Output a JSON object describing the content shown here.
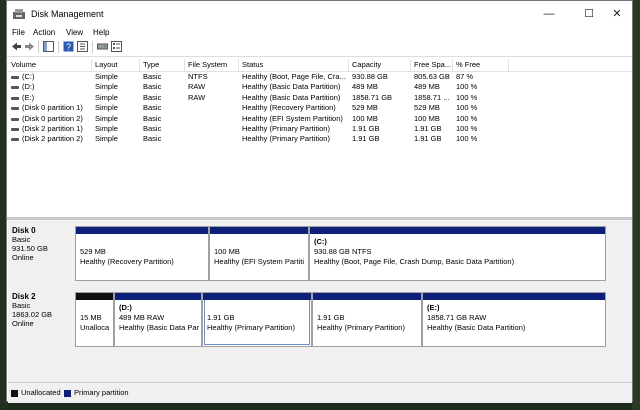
{
  "window": {
    "title": "Disk Management",
    "minimize": "—",
    "maximize": "☐",
    "close": "✕"
  },
  "menu": [
    "File",
    "Action",
    "View",
    "Help"
  ],
  "toolbar": [
    "back-arrow-icon",
    "forward-arrow-icon",
    "console-tree-icon",
    "help-icon",
    "properties-icon",
    "drive-icon",
    "list-icon"
  ],
  "table": {
    "columns": [
      "Volume",
      "Layout",
      "Type",
      "File System",
      "Status",
      "Capacity",
      "Free Spa...",
      "% Free"
    ],
    "rows": [
      [
        "(C:)",
        "Simple",
        "Basic",
        "NTFS",
        "Healthy (Boot, Page File, Cra...",
        "930.88 GB",
        "805.63 GB",
        "87 %"
      ],
      [
        "(D:)",
        "Simple",
        "Basic",
        "RAW",
        "Healthy (Basic Data Partition)",
        "489 MB",
        "489 MB",
        "100 %"
      ],
      [
        "(E:)",
        "Simple",
        "Basic",
        "RAW",
        "Healthy (Basic Data Partition)",
        "1858.71 GB",
        "1858.71 ...",
        "100 %"
      ],
      [
        "(Disk 0 partition 1)",
        "Simple",
        "Basic",
        "",
        "Healthy (Recovery Partition)",
        "529 MB",
        "529 MB",
        "100 %"
      ],
      [
        "(Disk 0 partition 2)",
        "Simple",
        "Basic",
        "",
        "Healthy (EFI System Partition)",
        "100 MB",
        "100 MB",
        "100 %"
      ],
      [
        "(Disk 2 partition 1)",
        "Simple",
        "Basic",
        "",
        "Healthy (Primary Partition)",
        "1.91 GB",
        "1.91 GB",
        "100 %"
      ],
      [
        "(Disk 2 partition 2)",
        "Simple",
        "Basic",
        "",
        "Healthy (Primary Partition)",
        "1.91 GB",
        "1.91 GB",
        "100 %"
      ]
    ]
  },
  "disks": [
    {
      "name": "Disk 0",
      "type": "Basic",
      "size": "931.50 GB",
      "status": "Online",
      "partitions": [
        {
          "name": "",
          "size": "529 MB",
          "status": "Healthy (Recovery Partition)",
          "kind": "primary"
        },
        {
          "name": "",
          "size": "100 MB",
          "status": "Healthy (EFI System Partiti",
          "kind": "primary"
        },
        {
          "name": "(C:)",
          "size": "930.88 GB NTFS",
          "status": "Healthy (Boot, Page File, Crash Dump, Basic Data Partition)",
          "kind": "primary"
        }
      ]
    },
    {
      "name": "Disk 2",
      "type": "Basic",
      "size": "1863.02 GB",
      "status": "Online",
      "partitions": [
        {
          "name": "",
          "size": "15 MB",
          "status": "Unalloca",
          "kind": "unallocated"
        },
        {
          "name": "(D:)",
          "size": "489 MB RAW",
          "status": "Healthy (Basic Data Part",
          "kind": "primary"
        },
        {
          "name": "",
          "size": "1.91 GB",
          "status": "Healthy (Primary Partition)",
          "kind": "primary"
        },
        {
          "name": "",
          "size": "1.91 GB",
          "status": "Healthy (Primary Partition)",
          "kind": "primary"
        },
        {
          "name": "(E:)",
          "size": "1858.71 GB RAW",
          "status": "Healthy (Basic Data Partition)",
          "kind": "primary"
        }
      ]
    }
  ],
  "legend": {
    "unallocated": "Unallocated",
    "primary": "Primary partition"
  },
  "colors": {
    "primary": "#0c1f7a",
    "unallocated": "#101010"
  }
}
